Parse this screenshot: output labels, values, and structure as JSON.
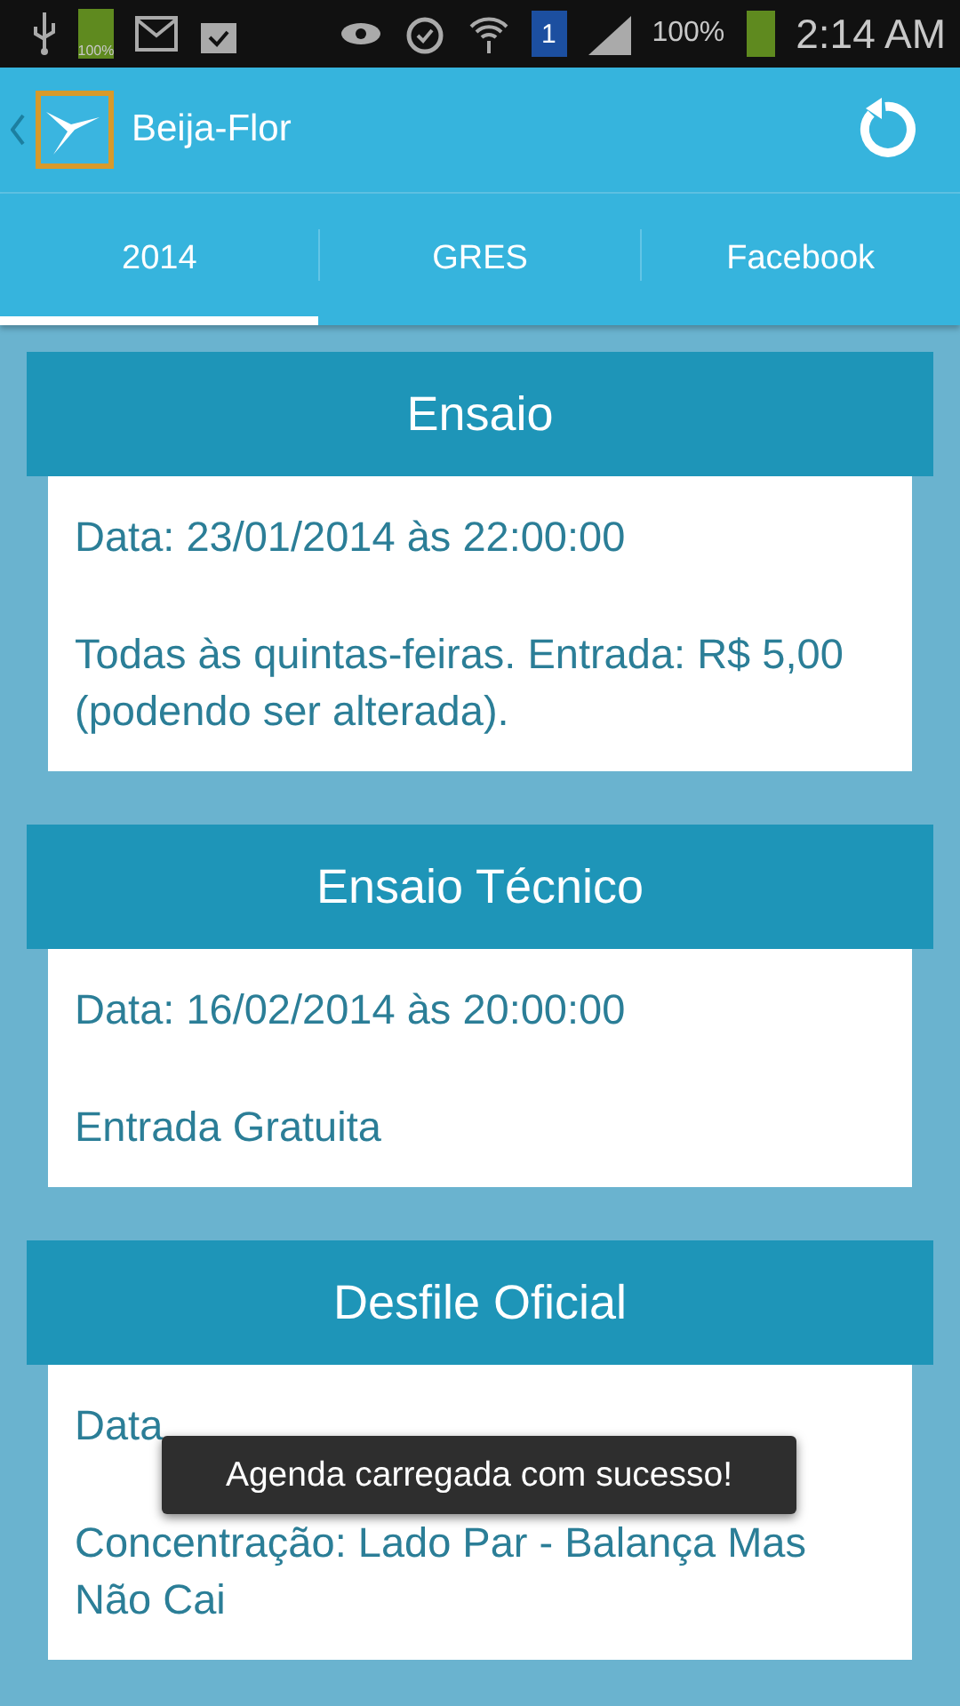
{
  "status_bar": {
    "battery_small": "100%",
    "sim": "1",
    "battery": "100%",
    "time": "2:14 AM"
  },
  "app_bar": {
    "title": "Beija-Flor"
  },
  "tabs": [
    {
      "label": "2014",
      "selected": true
    },
    {
      "label": "GRES",
      "selected": false
    },
    {
      "label": "Facebook",
      "selected": false
    }
  ],
  "events": [
    {
      "title": "Ensaio",
      "lines": [
        "Data: 23/01/2014 às 22:00:00",
        "Todas às quintas-feiras. Entrada: R$ 5,00 (podendo ser alterada)."
      ]
    },
    {
      "title": "Ensaio Técnico",
      "lines": [
        "Data: 16/02/2014 às 20:00:00",
        "Entrada Gratuita"
      ]
    },
    {
      "title": "Desfile Oficial",
      "lines": [
        "Data",
        "Concentração: Lado Par - Balança Mas Não Cai"
      ]
    }
  ],
  "toast": "Agenda carregada com sucesso!"
}
